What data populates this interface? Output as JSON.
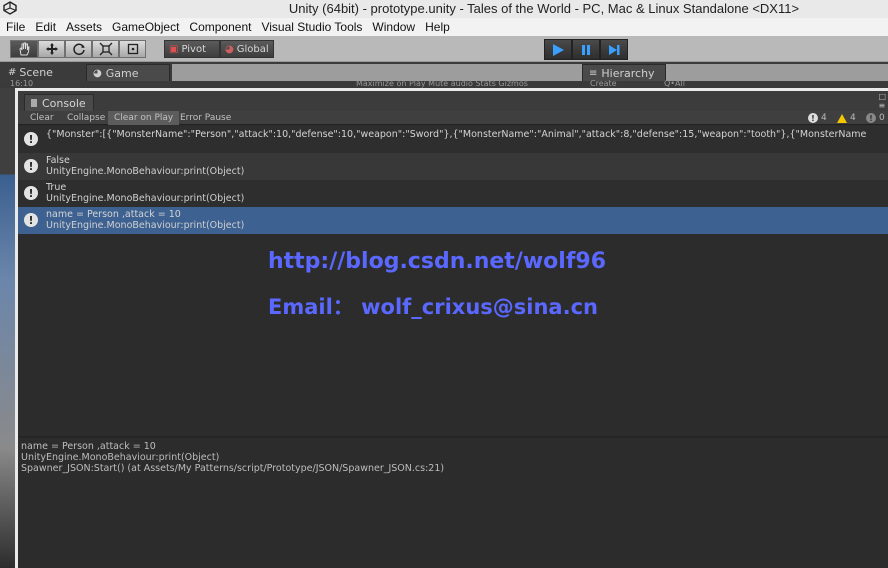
{
  "window": {
    "title": "Unity (64bit) - prototype.unity - Tales of the World - PC, Mac & Linux Standalone <DX11>"
  },
  "menu": [
    "File",
    "Edit",
    "Assets",
    "GameObject",
    "Component",
    "Visual Studio Tools",
    "Window",
    "Help"
  ],
  "toolbar": {
    "pivot_label": "Pivot",
    "global_label": "Global"
  },
  "tabs": {
    "scene": "Scene",
    "game": "Game",
    "hierarchy": "Hierarchy",
    "game_options": "Maximize on Play   Mute audio   Stats   Gizmos",
    "hierarchy_create": "Create",
    "hierarchy_search": "Q•All",
    "scene_aspect": "16:10"
  },
  "console": {
    "tab_label": "Console",
    "toolbar": {
      "clear": "Clear",
      "collapse": "Collapse",
      "clear_on_play": "Clear on Play",
      "error_pause": "Error Pause"
    },
    "counts": {
      "info": "4",
      "warnings": "4",
      "errors": "0"
    },
    "logs": [
      {
        "line1": "{\"Monster\":[{\"MonsterName\":\"Person\",\"attack\":10,\"defense\":10,\"weapon\":\"Sword\"},{\"MonsterName\":\"Animal\",\"attack\":8,\"defense\":15,\"weapon\":\"tooth\"},{\"MonsterName",
        "line2": ""
      },
      {
        "line1": "False",
        "line2": "UnityEngine.MonoBehaviour:print(Object)"
      },
      {
        "line1": "True",
        "line2": "UnityEngine.MonoBehaviour:print(Object)"
      },
      {
        "line1": "name = Person ,attack = 10",
        "line2": "UnityEngine.MonoBehaviour:print(Object)"
      }
    ],
    "detail": {
      "line1": "name = Person ,attack = 10",
      "line2": "UnityEngine.MonoBehaviour:print(Object)",
      "line3": "Spawner_JSON:Start() (at Assets/My Patterns/script/Prototype/JSON/Spawner_JSON.cs:21)"
    }
  },
  "watermark": {
    "url": "http://blog.csdn.net/wolf96",
    "email": "Email：  wolf_crixus@sina.cn"
  },
  "colors": {
    "selected_row": "#3d6191",
    "watermark": "#5a68ff",
    "play_accent": "#3aa0ff"
  }
}
